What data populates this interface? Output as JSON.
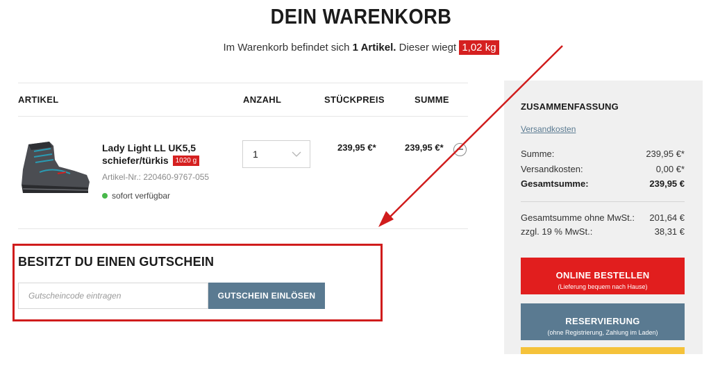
{
  "header": {
    "title": "DEIN WARENKORB",
    "info_prefix": "Im Warenkorb befindet sich",
    "info_count": "1 Artikel.",
    "info_suffix": "Dieser wiegt",
    "weight": "1,02 kg"
  },
  "table": {
    "headers": [
      "ARTIKEL",
      "ANZAHL",
      "STÜCKPREIS",
      "SUMME"
    ]
  },
  "item": {
    "name": "Lady Light LL UK5,5",
    "variant": "schiefer/türkis",
    "weight": "1020 g",
    "article_no": "Artikel-Nr.: 220460-9767-055",
    "availability": "sofort verfügbar",
    "availability_color": "#48b84a",
    "quantity": "1",
    "unit_price": "239,95 €*",
    "total": "239,95 €*",
    "image_icon": "boot-image",
    "remove_icon": "remove-circle-icon"
  },
  "coupon": {
    "title": "BESITZT DU EINEN GUTSCHEIN",
    "placeholder": "Gutscheincode eintragen",
    "button_label": "GUTSCHEIN EINLÖSEN"
  },
  "summary": {
    "title": "ZUSAMMENFASSUNG",
    "shipping_link": "Versandkosten",
    "rows": [
      {
        "label": "Summe:",
        "value": "239,95 €*"
      },
      {
        "label": "Versandkosten:",
        "value": "0,00 €*"
      },
      {
        "label": "Gesamtsumme:",
        "value": "239,95 €"
      },
      {
        "label": "Gesamtsumme ohne MwSt.:",
        "value": "201,64 €"
      },
      {
        "label": "zzgl. 19 % MwSt.:",
        "value": "38,31 €"
      }
    ],
    "order_button": {
      "label": "ONLINE BESTELLEN",
      "sub": "(Lieferung bequem nach Hause)"
    },
    "reserve_button": {
      "label": "RESERVIERUNG",
      "sub": "(ohne Registrierung, Zahlung im Laden)"
    }
  },
  "colors": {
    "accent_red": "#e11e1e",
    "slate_blue": "#5a7a91",
    "annotation_red": "#d01c1c",
    "paypal_yellow": "#f5c23a"
  }
}
